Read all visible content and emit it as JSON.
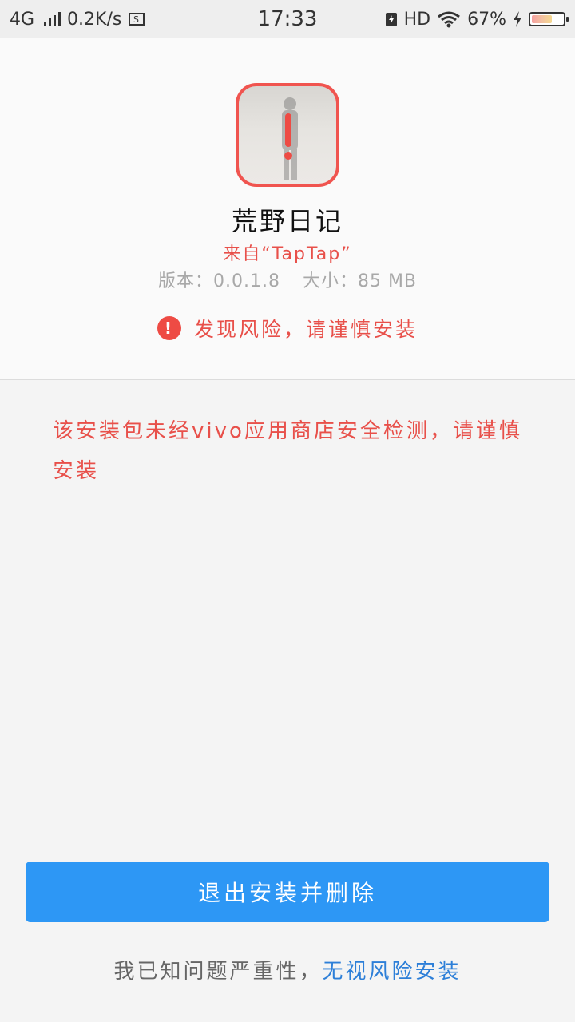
{
  "status_bar": {
    "network": "4G",
    "speed": "0.2K/s",
    "time": "17:33",
    "hd": "HD",
    "battery_percent": "67%",
    "battery_level": 0.67
  },
  "app": {
    "name": "荒野日记",
    "source": "来自“TapTap”",
    "version": "版本：0.0.1.8",
    "size": "大小：85 MB",
    "risk_label": "发现风险，请谨慎安装",
    "risk_icon": "!"
  },
  "warning": {
    "text": "该安装包未经vivo应用商店安全检测，请谨慎安装"
  },
  "actions": {
    "exit_delete": "退出安装并删除",
    "footer_prefix": "我已知问题严重性，",
    "ignore_install": "无视风险安装"
  },
  "colors": {
    "accent_blue": "#2d97f5",
    "danger_red": "#e8504a",
    "link_blue": "#2d7fd8"
  }
}
